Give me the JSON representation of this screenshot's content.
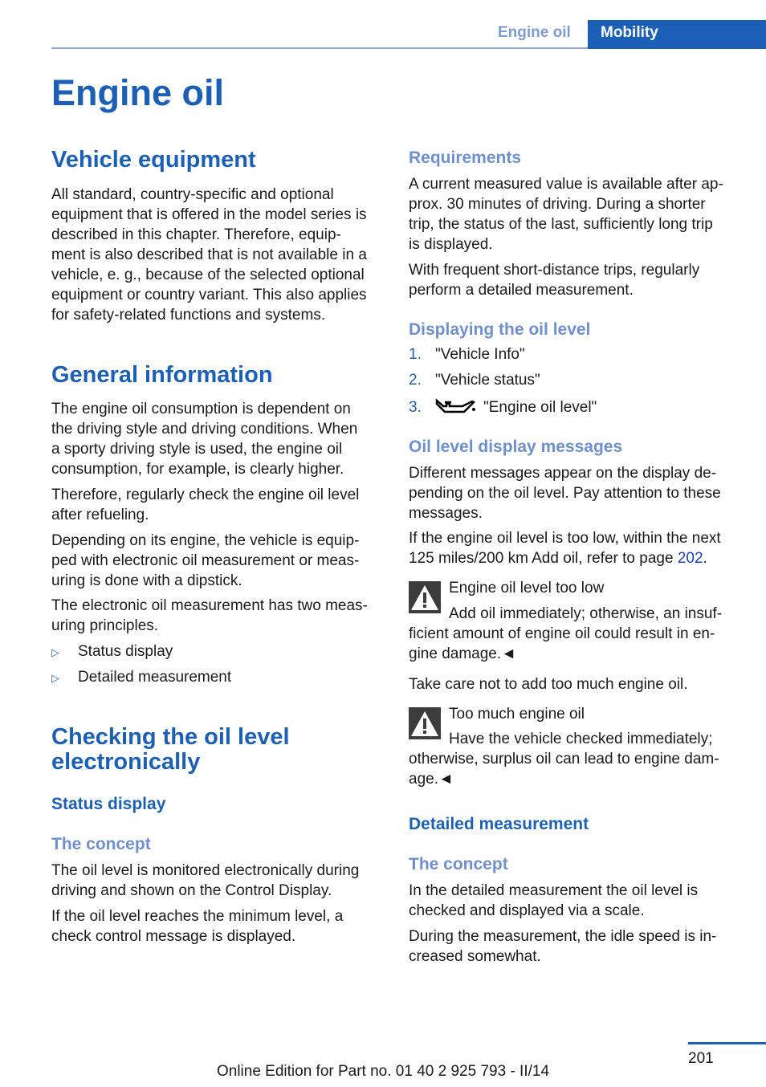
{
  "header": {
    "section": "Engine oil",
    "chapter": "Mobility"
  },
  "title": "Engine oil",
  "left": {
    "vehicle_equipment": {
      "heading": "Vehicle equipment",
      "lines": [
        "All standard, country-specific and optional",
        "equipment that is offered in the model series is",
        "described in this chapter. Therefore, equip-",
        "ment is also described that is not available in a",
        "vehicle, e. g., because of the selected optional",
        "equipment or country variant. This also applies",
        "for safety-related functions and systems."
      ]
    },
    "general": {
      "heading": "General information",
      "p1": [
        "The engine oil consumption is dependent on",
        "the driving style and driving conditions. When",
        "a sporty driving style is used, the engine oil",
        "consumption, for example, is clearly higher."
      ],
      "p2": [
        "Therefore, regularly check the engine oil level",
        "after refueling."
      ],
      "p3": [
        "Depending on its engine, the vehicle is equip-",
        "ped with electronic oil measurement or meas-",
        "uring is done with a dipstick."
      ],
      "p4": [
        "The electronic oil measurement has two meas-",
        "uring principles."
      ],
      "bullets": [
        "Status display",
        "Detailed measurement"
      ]
    },
    "checking": {
      "heading_l1": "Checking the oil level",
      "heading_l2": "electronically",
      "sub": "Status display",
      "concept": "The concept",
      "p1": [
        "The oil level is monitored electronically during",
        "driving and shown on the Control Display."
      ],
      "p2": [
        "If the oil level reaches the minimum level, a",
        "check control message is displayed."
      ]
    }
  },
  "right": {
    "requirements": {
      "heading": "Requirements",
      "p1": [
        "A current measured value is available after ap-",
        "prox. 30 minutes of driving. During a shorter",
        "trip, the status of the last, sufficiently long trip",
        "is displayed."
      ],
      "p2": [
        "With frequent short-distance trips, regularly",
        "perform a detailed measurement."
      ]
    },
    "displaying": {
      "heading": "Displaying the oil level",
      "steps": [
        {
          "n": "1.",
          "text": "\"Vehicle Info\""
        },
        {
          "n": "2.",
          "text": "\"Vehicle status\""
        },
        {
          "n": "3.",
          "text": "\"Engine oil level\"",
          "icon": "oil-can-icon"
        }
      ]
    },
    "messages": {
      "heading": "Oil level display messages",
      "p1": [
        "Different messages appear on the display de-",
        "pending on the oil level. Pay attention to these",
        "messages."
      ],
      "p2_l1": "If the engine oil level is too low, within the next",
      "p2_l2": "125 miles/200 km Add oil, refer to page ",
      "p2_link": "202",
      "p2_end": ".",
      "warn1": {
        "title": "Engine oil level too low",
        "l1": "Add oil immediately; otherwise, an insuf-",
        "l2": "ficient amount of engine oil could result in en-",
        "l3": "gine damage.◄"
      },
      "p3": "Take care not to add too much engine oil.",
      "warn2": {
        "title": "Too much engine oil",
        "l1": "Have the vehicle checked immediately;",
        "l2": "otherwise, surplus oil can lead to engine dam-",
        "l3": "age.◄"
      }
    },
    "detailed": {
      "heading": "Detailed measurement",
      "concept": "The concept",
      "p1": [
        "In the detailed measurement the oil level is",
        "checked and displayed via a scale."
      ],
      "p2": [
        "During the measurement, the idle speed is in-",
        "creased somewhat."
      ]
    }
  },
  "footer": {
    "edition": "Online Edition for Part no. 01 40 2 925 793 - II/14",
    "page": "201"
  }
}
